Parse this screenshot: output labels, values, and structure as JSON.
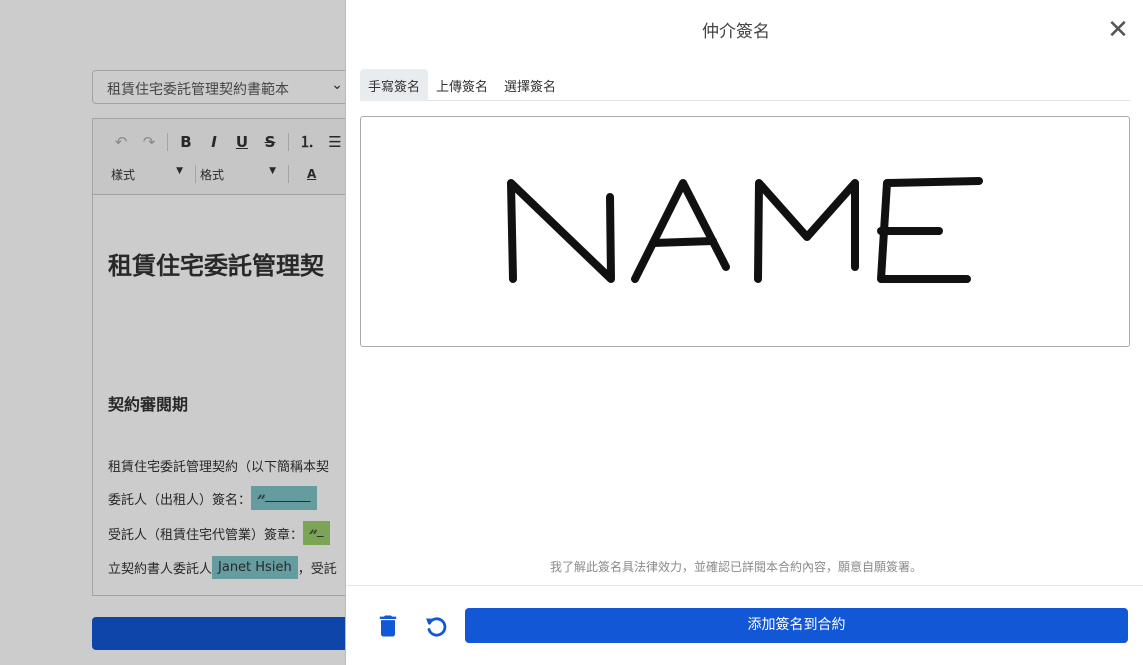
{
  "background": {
    "template_select": "租賃住宅委託管理契約書範本",
    "toolbar": {
      "undo_label": "↶",
      "redo_label": "↷",
      "bold_label": "B",
      "italic_label": "I",
      "underline_label": "U",
      "strike_label": "S",
      "style_combo": "樣式",
      "format_combo": "格式",
      "text_color_label": "A"
    },
    "document": {
      "title": "租賃住宅委託管理契",
      "section_heading": "契約審閱期",
      "line1": "租賃住宅委託管理契約（以下簡稱本契",
      "line2_label": "委託人（出租人）簽名：",
      "line2_sig": "𝓃_______",
      "line3_label": "受託人（租賃住宅代管業）簽章：",
      "line3_sig": "𝓃_",
      "line4_label": "立契約書人委託人",
      "line4_name": "Janet Hsieh",
      "line4_suffix": "，受託"
    }
  },
  "modal": {
    "title": "仲介簽名",
    "close_label": "✕",
    "tabs": [
      {
        "label": "手寫簽名",
        "active": true
      },
      {
        "label": "上傳簽名",
        "active": false
      },
      {
        "label": "選擇簽名",
        "active": false
      }
    ],
    "signature_drawn_text": "NAME",
    "disclaimer": "我了解此簽名具法律效力，並確認已詳閱本合約內容，願意自願簽署。",
    "add_button_label": "添加簽名到合約",
    "accent_color": "#1257d6"
  }
}
